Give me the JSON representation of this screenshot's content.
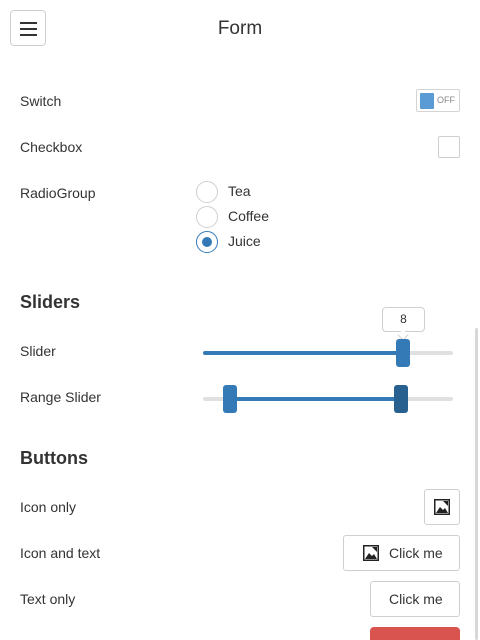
{
  "header": {
    "title": "Form",
    "menu_icon": "hamburger-menu-icon"
  },
  "switch": {
    "label": "Switch",
    "state_text": "OFF"
  },
  "checkbox": {
    "label": "Checkbox",
    "checked": false
  },
  "radio_group": {
    "label": "RadioGroup",
    "options": [
      "Tea",
      "Coffee",
      "Juice"
    ],
    "selected": "Juice"
  },
  "sliders": {
    "title": "Sliders",
    "slider": {
      "label": "Slider",
      "value": "8"
    },
    "range_slider": {
      "label": "Range Slider"
    }
  },
  "buttons": {
    "title": "Buttons",
    "icon_only": {
      "label": "Icon only",
      "icon": "image-icon"
    },
    "icon_and_text": {
      "label": "Icon and text",
      "button_text": "Click me",
      "icon": "image-icon"
    },
    "text_only": {
      "label": "Text only",
      "button_text": "Click me"
    }
  },
  "colors": {
    "accent": "#337ab7",
    "accent_dark": "#28608f",
    "danger": "#d9534f"
  }
}
